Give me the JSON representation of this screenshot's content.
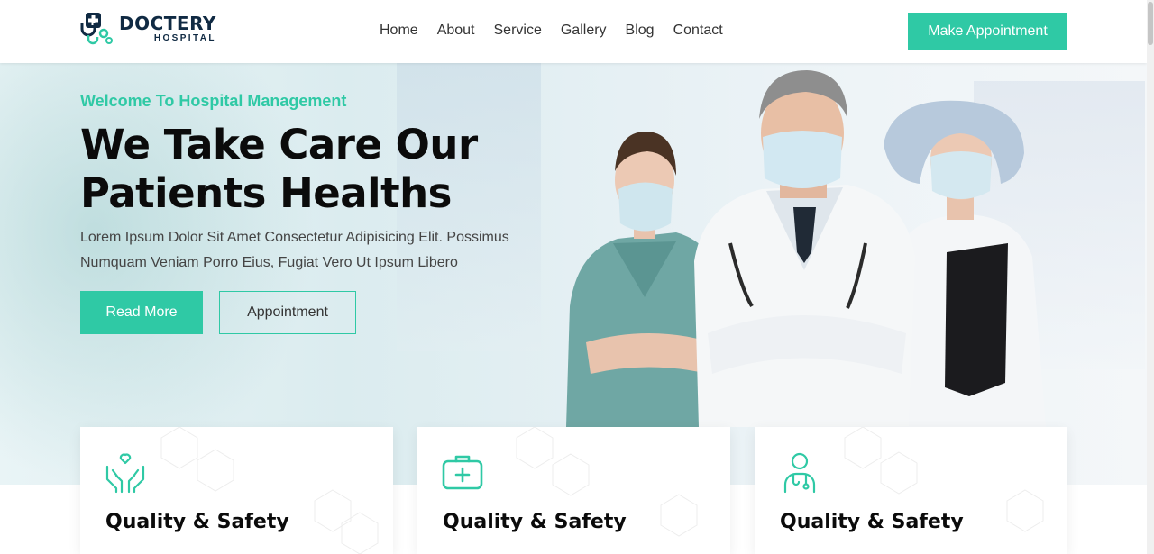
{
  "brand": {
    "name": "DOCTERY",
    "subtitle": "HOSPITAL",
    "accent": "#2fc9a5",
    "dark": "#102a43"
  },
  "nav": {
    "items": [
      "Home",
      "About",
      "Service",
      "Gallery",
      "Blog",
      "Contact"
    ]
  },
  "header": {
    "cta_label": "Make Appointment"
  },
  "hero": {
    "welcome": "Welcome To Hospital Management",
    "headline_line1": "We Take Care Our",
    "headline_line2": "Patients Healths",
    "description_line1": "Lorem Ipsum Dolor Sit Amet Consectetur Adipisicing Elit. Possimus",
    "description_line2": "Numquam Veniam Porro Eius, Fugiat Vero Ut Ipsum Libero",
    "read_more_label": "Read More",
    "appointment_label": "Appointment"
  },
  "features": [
    {
      "title": "Quality & Safety",
      "icon": "care-hands-heart-icon"
    },
    {
      "title": "Quality & Safety",
      "icon": "medical-kit-icon"
    },
    {
      "title": "Quality & Safety",
      "icon": "doctor-icon"
    }
  ]
}
